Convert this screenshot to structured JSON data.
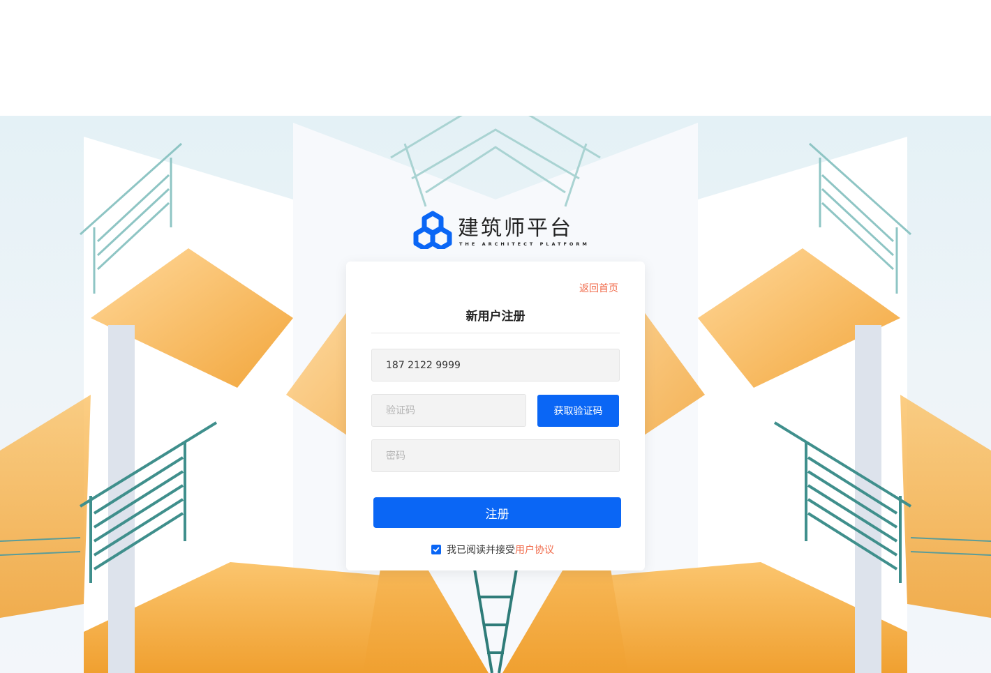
{
  "brand": {
    "name": "建筑师平台",
    "subtitle": "THE ARCHITECT PLATFORM",
    "color": "#0a66f5"
  },
  "register": {
    "back_link": "返回首页",
    "title": "新用户注册",
    "phone": {
      "value": "187 2122 9999",
      "placeholder": ""
    },
    "code": {
      "value": "",
      "placeholder": "验证码"
    },
    "get_code_button": "获取验证码",
    "password": {
      "value": "",
      "placeholder": "密码"
    },
    "submit_button": "注册",
    "agreement": {
      "checked": true,
      "text": "我已阅读并接受",
      "link": "用户协议"
    }
  },
  "colors": {
    "primary": "#0a66f5",
    "link": "#f06a4a"
  },
  "icons": {
    "logo": "hexagon-cube-logo-icon",
    "checkbox": "checkmark-icon"
  }
}
